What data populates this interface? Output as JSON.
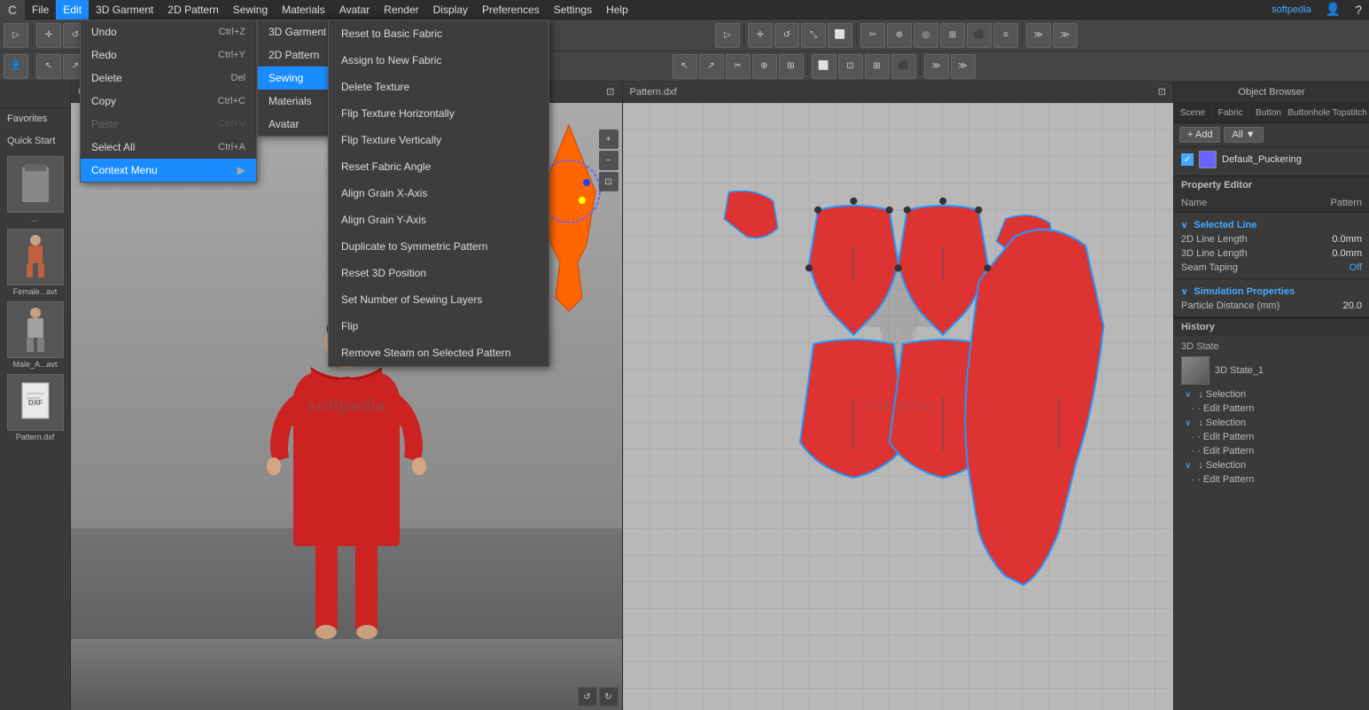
{
  "app": {
    "title": "Untitled.ZPrj",
    "logo": "C",
    "watermark": "softpedia"
  },
  "menubar": {
    "items": [
      {
        "label": "File",
        "name": "file"
      },
      {
        "label": "Edit",
        "name": "edit",
        "active": true
      },
      {
        "label": "3D Garment",
        "name": "3d-garment"
      },
      {
        "label": "2D Pattern",
        "name": "2d-pattern"
      },
      {
        "label": "Sewing",
        "name": "sewing"
      },
      {
        "label": "Materials",
        "name": "materials"
      },
      {
        "label": "Avatar",
        "name": "avatar"
      },
      {
        "label": "Render",
        "name": "render"
      },
      {
        "label": "Display",
        "name": "display"
      },
      {
        "label": "Preferences",
        "name": "preferences"
      },
      {
        "label": "Settings",
        "name": "settings"
      },
      {
        "label": "Help",
        "name": "help"
      }
    ],
    "right_text": "softpedia"
  },
  "edit_menu": {
    "items": [
      {
        "label": "Undo",
        "shortcut": "Ctrl+Z",
        "disabled": false
      },
      {
        "label": "Redo",
        "shortcut": "Ctrl+Y",
        "disabled": false
      },
      {
        "label": "Delete",
        "shortcut": "Del",
        "disabled": false
      },
      {
        "label": "Copy",
        "shortcut": "Ctrl+C",
        "disabled": false
      },
      {
        "label": "Paste",
        "shortcut": "Ctrl+V",
        "disabled": true
      },
      {
        "label": "Select All",
        "shortcut": "Ctrl+A",
        "disabled": false
      },
      {
        "label": "Context Menu",
        "shortcut": "",
        "disabled": false,
        "has_arrow": true,
        "highlighted": true
      }
    ]
  },
  "context_menu": {
    "items": [
      {
        "label": "3D Garment",
        "has_arrow": true
      },
      {
        "label": "2D Pattern",
        "has_arrow": true
      },
      {
        "label": "Sewing",
        "has_arrow": true,
        "active": true
      },
      {
        "label": "Materials",
        "has_arrow": true
      },
      {
        "label": "Avatar",
        "has_arrow": true
      }
    ]
  },
  "sewing_submenu": {
    "items": [
      {
        "label": "Reset to Basic Fabric"
      },
      {
        "label": "Assign to New Fabric"
      },
      {
        "label": "Delete Texture"
      },
      {
        "label": "Flip Texture Horizontally"
      },
      {
        "label": "Flip Texture Vertically"
      },
      {
        "label": "Reset Fabric Angle"
      },
      {
        "label": "Align Grain X-Axis"
      },
      {
        "label": "Align Grain Y-Axis"
      },
      {
        "label": "Duplicate to Symmetric Pattern"
      },
      {
        "label": "Reset 3D Position"
      },
      {
        "label": "Set Number of Sewing Layers"
      },
      {
        "label": "Flip"
      },
      {
        "label": "Remove Steam on Selected Pattern"
      }
    ]
  },
  "viewports": {
    "left": {
      "title": "Untitled.ZPrj",
      "icon": "expand"
    },
    "right": {
      "title": "Pattern.dxf",
      "icon": "expand"
    }
  },
  "right_panel": {
    "title": "Object Browser",
    "tabs": [
      {
        "label": "Scene"
      },
      {
        "label": "Fabric"
      },
      {
        "label": "Button"
      },
      {
        "label": "Buttonhole"
      },
      {
        "label": "Topstitch"
      }
    ],
    "add_label": "+ Add",
    "all_label": "All ▼",
    "items": [
      {
        "checked": true,
        "color": "#6666cc",
        "label": "Default_Puckering"
      }
    ]
  },
  "property_editor": {
    "title": "Property Editor",
    "columns": [
      "Name",
      "Pattern"
    ],
    "selected_line": {
      "label": "Selected Line",
      "properties": [
        {
          "label": "2D Line Length",
          "value": "0.0mm"
        },
        {
          "label": "3D Line Length",
          "value": "0.0mm"
        },
        {
          "label": "Seam Taping",
          "value": "Off"
        }
      ]
    },
    "simulation_properties": {
      "label": "Simulation Properties",
      "properties": [
        {
          "label": "Particle Distance (mm)",
          "value": "20.0"
        }
      ]
    }
  },
  "history": {
    "title": "History",
    "state_label": "3D State",
    "items": [
      {
        "label": "3D State_1"
      },
      {
        "label": "↓ Selection"
      },
      {
        "label": "∙ Edit Pattern"
      },
      {
        "label": "↓ Selection"
      },
      {
        "label": "∙ Edit Pattern"
      },
      {
        "label": "∙ Edit Pattern"
      },
      {
        "label": "↓ Selection"
      },
      {
        "label": "∙ Edit Pattern"
      }
    ]
  },
  "left_panel": {
    "favorites_label": "Favorites",
    "quick_start_label": "Quick Start",
    "thumbnails": [
      {
        "label": "...",
        "type": "garment"
      },
      {
        "label": "Female...avt",
        "type": "avatar-female"
      },
      {
        "label": "Male_A...avt",
        "type": "avatar-male"
      },
      {
        "label": "Pattern.dxf",
        "type": "pattern"
      }
    ]
  },
  "icons": {
    "arrow_right": "▶",
    "checkmark": "✓",
    "expand": "⊡",
    "fold_down": "∨",
    "fold_right": "›"
  }
}
